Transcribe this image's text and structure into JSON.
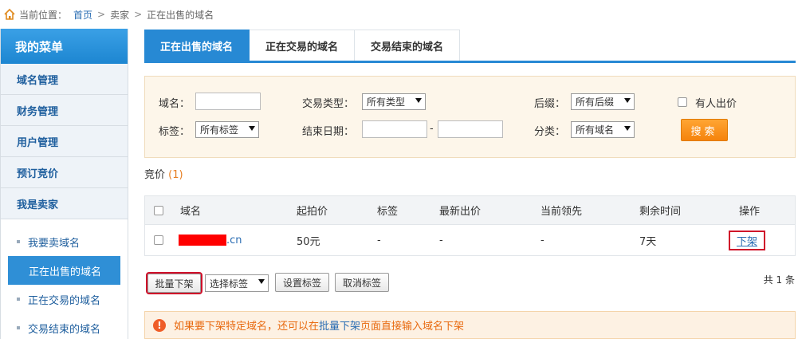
{
  "breadcrumb": {
    "prefix": "当前位置：",
    "home": "首页",
    "sep1": ">",
    "seller": "卖家",
    "sep2": ">",
    "current": "正在出售的域名"
  },
  "sidebar": {
    "title": "我的菜单",
    "items": [
      {
        "label": "域名管理"
      },
      {
        "label": "财务管理"
      },
      {
        "label": "用户管理"
      },
      {
        "label": "预订竞价"
      },
      {
        "label": "我是卖家"
      }
    ],
    "subitems": [
      {
        "label": "我要卖域名",
        "active": false
      },
      {
        "label": "正在出售的域名",
        "active": true
      },
      {
        "label": "正在交易的域名",
        "active": false
      },
      {
        "label": "交易结束的域名",
        "active": false
      }
    ]
  },
  "tabs": [
    {
      "label": "正在出售的域名",
      "active": true
    },
    {
      "label": "正在交易的域名",
      "active": false
    },
    {
      "label": "交易结束的域名",
      "active": false
    }
  ],
  "filter": {
    "domain_label": "域名：",
    "tag_label": "标签：",
    "tag_value": "所有标签",
    "type_label": "交易类型：",
    "type_value": "所有类型",
    "enddate_label": "结束日期：",
    "enddate_sep": "-",
    "suffix_label": "后缀：",
    "suffix_value": "所有后缀",
    "category_label": "分类：",
    "category_value": "所有域名",
    "has_bid_label": "有人出价",
    "search_label": "搜索"
  },
  "bid": {
    "title": "竞价",
    "count": "(1)"
  },
  "table": {
    "headers": [
      "域名",
      "起拍价",
      "标签",
      "最新出价",
      "当前领先",
      "剩余时间",
      "操作"
    ],
    "rows": [
      {
        "domain_ext": ".cn",
        "start_price": "50元",
        "tag": "-",
        "latest_bid": "-",
        "leader": "-",
        "remaining": "7天",
        "action": "下架"
      }
    ]
  },
  "actions": {
    "bulk_delist": "批量下架",
    "select_tag": "选择标签",
    "set_tag": "设置标签",
    "cancel_tag": "取消标签",
    "total": "共 1 条"
  },
  "notice": {
    "icon": "!",
    "before": "如果要下架特定域名，还可以在",
    "link": "批量下架",
    "after": "页面直接输入域名下架"
  },
  "colors": {
    "accent": "#2789d4",
    "orange": "#f5830c",
    "highlight": "#d0102a",
    "redaction": "#ff0000"
  }
}
